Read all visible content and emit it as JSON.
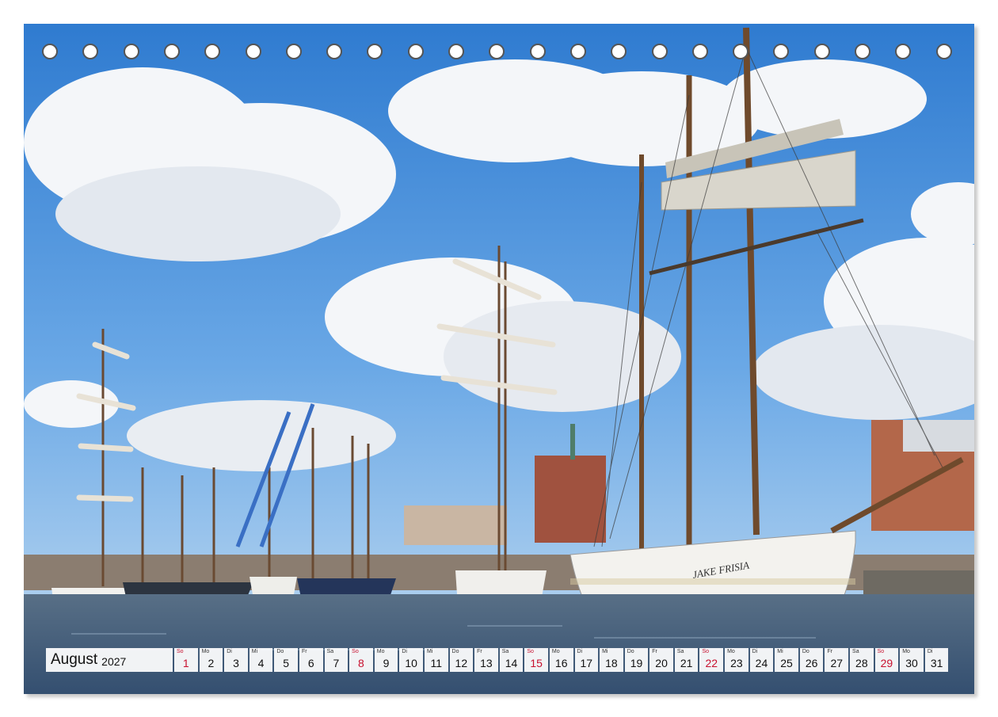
{
  "calendar": {
    "month": "August",
    "year": "2027",
    "days": [
      {
        "dow": "So",
        "num": "1",
        "sunday": true
      },
      {
        "dow": "Mo",
        "num": "2"
      },
      {
        "dow": "Di",
        "num": "3"
      },
      {
        "dow": "Mi",
        "num": "4"
      },
      {
        "dow": "Do",
        "num": "5"
      },
      {
        "dow": "Fr",
        "num": "6"
      },
      {
        "dow": "Sa",
        "num": "7"
      },
      {
        "dow": "So",
        "num": "8",
        "sunday": true
      },
      {
        "dow": "Mo",
        "num": "9"
      },
      {
        "dow": "Di",
        "num": "10"
      },
      {
        "dow": "Mi",
        "num": "11"
      },
      {
        "dow": "Do",
        "num": "12"
      },
      {
        "dow": "Fr",
        "num": "13"
      },
      {
        "dow": "Sa",
        "num": "14"
      },
      {
        "dow": "So",
        "num": "15",
        "sunday": true
      },
      {
        "dow": "Mo",
        "num": "16"
      },
      {
        "dow": "Di",
        "num": "17"
      },
      {
        "dow": "Mi",
        "num": "18"
      },
      {
        "dow": "Do",
        "num": "19"
      },
      {
        "dow": "Fr",
        "num": "20"
      },
      {
        "dow": "Sa",
        "num": "21"
      },
      {
        "dow": "So",
        "num": "22",
        "sunday": true
      },
      {
        "dow": "Mo",
        "num": "23"
      },
      {
        "dow": "Di",
        "num": "24"
      },
      {
        "dow": "Mi",
        "num": "25"
      },
      {
        "dow": "Do",
        "num": "26"
      },
      {
        "dow": "Fr",
        "num": "27"
      },
      {
        "dow": "Sa",
        "num": "28"
      },
      {
        "dow": "So",
        "num": "29",
        "sunday": true
      },
      {
        "dow": "Mo",
        "num": "30"
      },
      {
        "dow": "Di",
        "num": "31"
      }
    ]
  },
  "photo": {
    "ship_name": "JAKE FRISIA"
  },
  "colors": {
    "sunday": "#c8102e",
    "sky": "#4a8fd6",
    "water": "#3d5d82"
  }
}
